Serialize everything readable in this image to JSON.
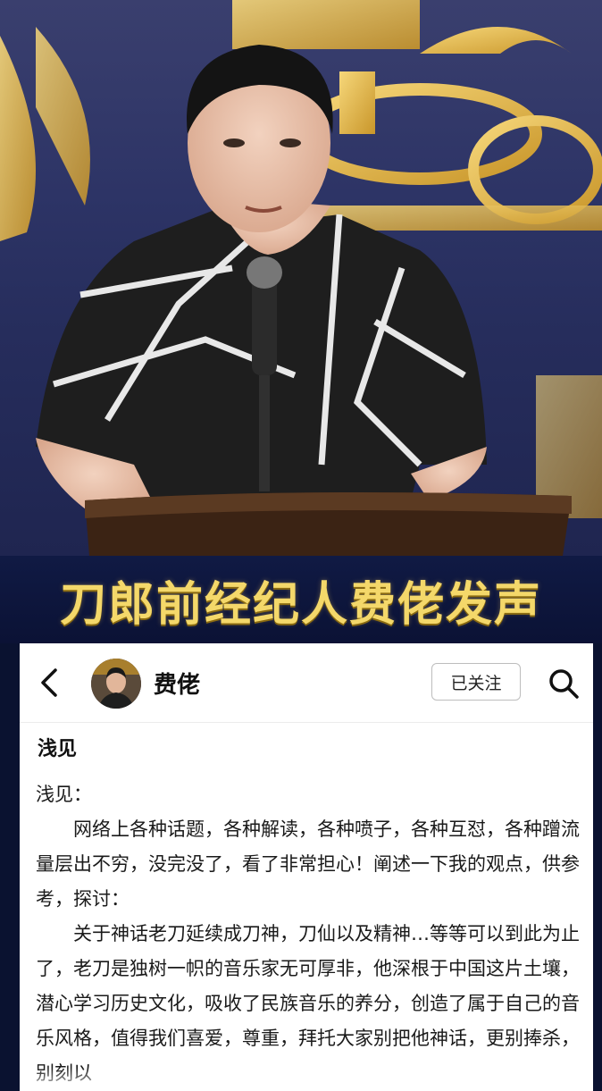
{
  "banner": {
    "title": "刀郎前经纪人费佬发声"
  },
  "photo": {
    "description_icon": "speaker-photo"
  },
  "nav": {
    "back_icon": "chevron-left-icon",
    "username": "费佬",
    "follow_label": "已关注",
    "search_icon": "search-icon"
  },
  "post": {
    "title": "浅见",
    "paragraphs": [
      "浅见：",
      "网络上各种话题，各种解读，各种喷子，各种互怼，各种蹭流量层出不穷，没完没了，看了非常担心！阐述一下我的观点，供参考，探讨：",
      "关于神话老刀延续成刀神，刀仙以及精神…等等可以到此为止了，老刀是独树一帜的音乐家无可厚非，他深根于中国这片土壤，潜心学习历史文化，吸收了民族音乐的养分，创造了属于自己的音乐风格，值得我们喜爱，尊重，拜托大家别把他神话，更别捧杀，别刻以"
    ]
  },
  "colors": {
    "banner_text": "#f4d86a",
    "banner_bg": "#0b1235"
  }
}
